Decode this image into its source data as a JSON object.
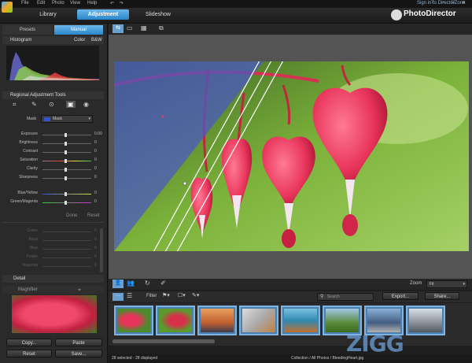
{
  "menu": [
    "File",
    "Edit",
    "Photo",
    "View",
    "Help"
  ],
  "window": {
    "signin": "Sign in to DirectorZone",
    "help": "?",
    "minimize": "–",
    "maximize": "□",
    "close": "✕"
  },
  "brand": {
    "name": "PhotoDirector"
  },
  "main_tabs": {
    "library": "Library",
    "adjustment": "Adjustment",
    "slideshow": "Slideshow"
  },
  "left": {
    "presets_tab": "Presets",
    "manual_tab": "Manual",
    "histogram": {
      "title": "Histogram",
      "color": "Color",
      "bw": "B&W"
    },
    "regional": {
      "title": "Regional Adjustment Tools",
      "mask_label": "Mask",
      "mask_value": "Mask",
      "sliders": [
        {
          "label": "Exposure",
          "value": "0.00"
        },
        {
          "label": "Brightness",
          "value": "0"
        },
        {
          "label": "Contrast",
          "value": "0"
        },
        {
          "label": "Saturation",
          "value": "0"
        },
        {
          "label": "Clarity",
          "value": "0"
        },
        {
          "label": "Sharpness",
          "value": "0"
        }
      ],
      "color_sliders": [
        {
          "label": "Blue/Yellow",
          "value": "0"
        },
        {
          "label": "Green/Magenta",
          "value": "0"
        }
      ],
      "done": "Done",
      "reset": "Reset"
    },
    "hsl_rows": [
      {
        "label": "Green",
        "value": "0"
      },
      {
        "label": "Aqua",
        "value": "0"
      },
      {
        "label": "Blue",
        "value": "0"
      },
      {
        "label": "Purple",
        "value": "0"
      },
      {
        "label": "Magenta",
        "value": "0"
      }
    ],
    "detail_title": "Detail",
    "magnifier_title": "Magnifier",
    "buttons": {
      "copy": "Copy...",
      "paste": "Paste",
      "reset": "Reset",
      "save": "Save..."
    }
  },
  "view": {
    "zoom_label": "Zoom",
    "zoom_value": "Fit"
  },
  "film": {
    "filter_label": "Filter",
    "search_placeholder": "Search",
    "export": "Export...",
    "share": "Share..."
  },
  "status": {
    "selection": "28 selected - 28 displayed",
    "path": "Collection / All Photos / BleedingHeart.jpg"
  },
  "watermark": "ZIGG",
  "colors": {
    "accent": "#2a86c8",
    "panel": "#2a2a2a",
    "flower": "#e8345a"
  }
}
